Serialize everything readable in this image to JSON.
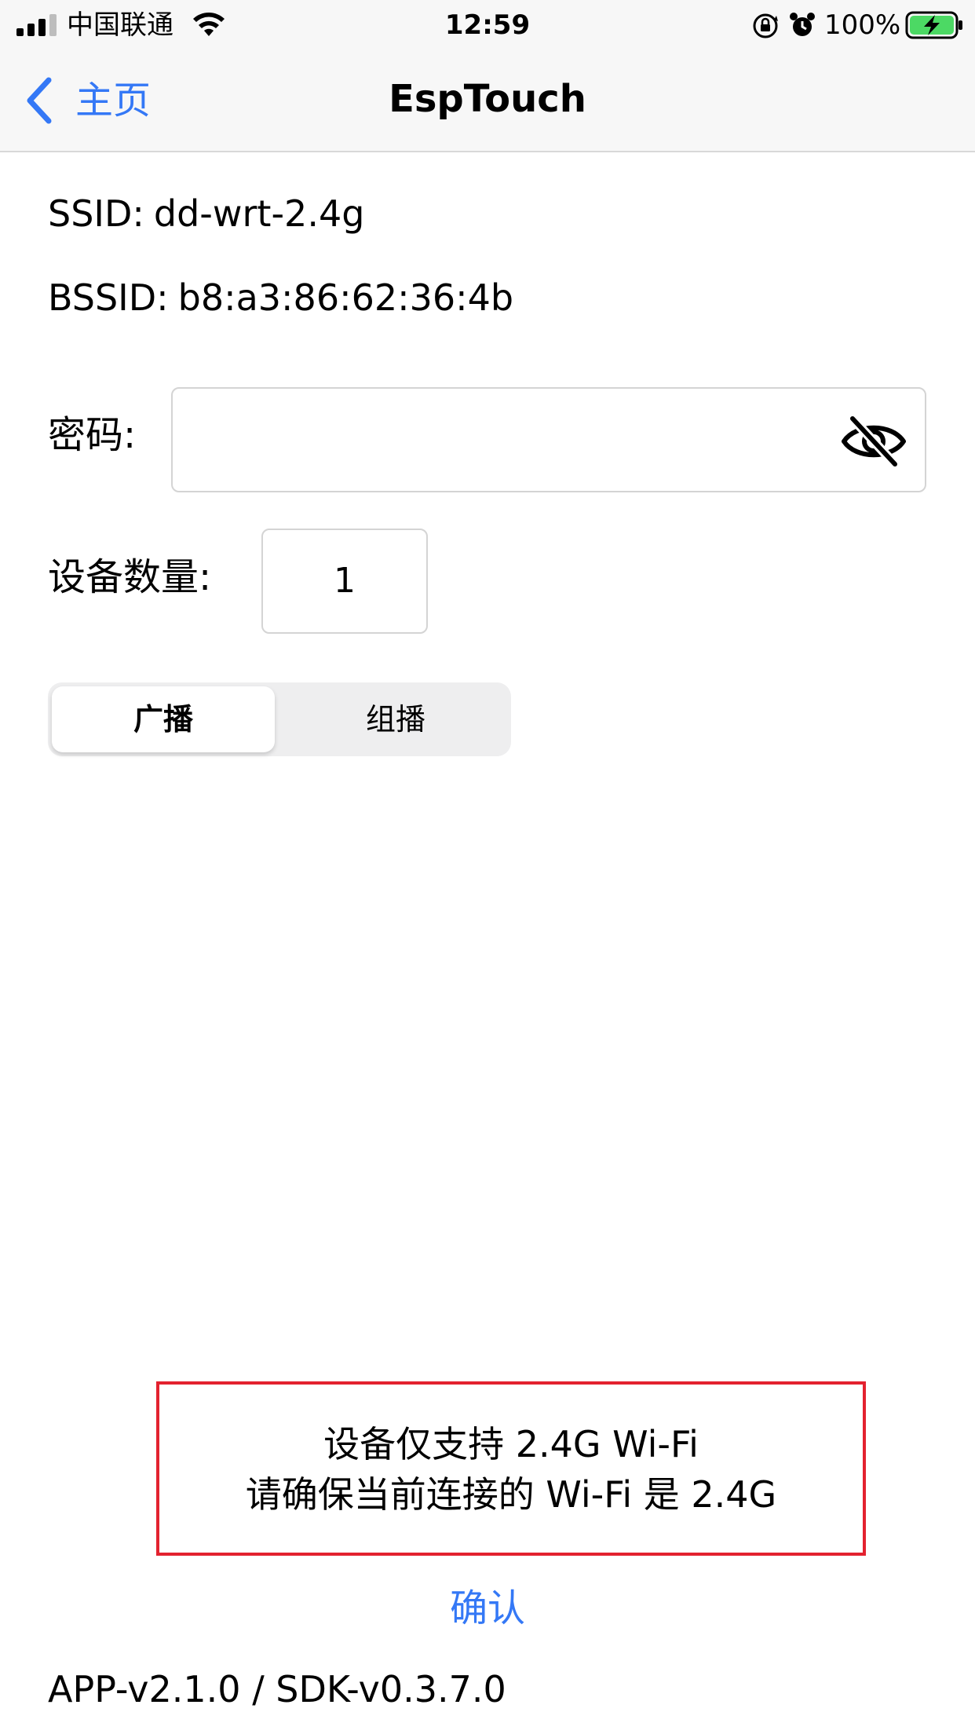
{
  "status_bar": {
    "carrier": "中国联通",
    "time": "12:59",
    "battery_percent": "100%",
    "battery_level": 1.0,
    "icons": [
      "signal-icon",
      "wifi-icon",
      "orientation-lock-icon",
      "alarm-icon",
      "battery-charging-icon"
    ]
  },
  "nav": {
    "back_label": "主页",
    "title": "EspTouch",
    "accent_color": "#3478f6"
  },
  "info": {
    "ssid_label": "SSID:",
    "ssid_value": "dd-wrt-2.4g",
    "bssid_label": "BSSID:",
    "bssid_value": "b8:a3:86:62:36:4b"
  },
  "form": {
    "password_label": "密码:",
    "password_value": "",
    "password_toggle_icon": "eye-slash-icon",
    "device_count_label": "设备数量:",
    "device_count_value": "1"
  },
  "mode_selector": {
    "options": [
      "广播",
      "组播"
    ],
    "selected": "广播"
  },
  "notice": {
    "line1": "设备仅支持 2.4G Wi-Fi",
    "line2": "请确保当前连接的 Wi-Fi 是 2.4G",
    "border_color": "#e3222f"
  },
  "confirm_label": "确认",
  "version": "APP-v2.1.0 / SDK-v0.3.7.0"
}
